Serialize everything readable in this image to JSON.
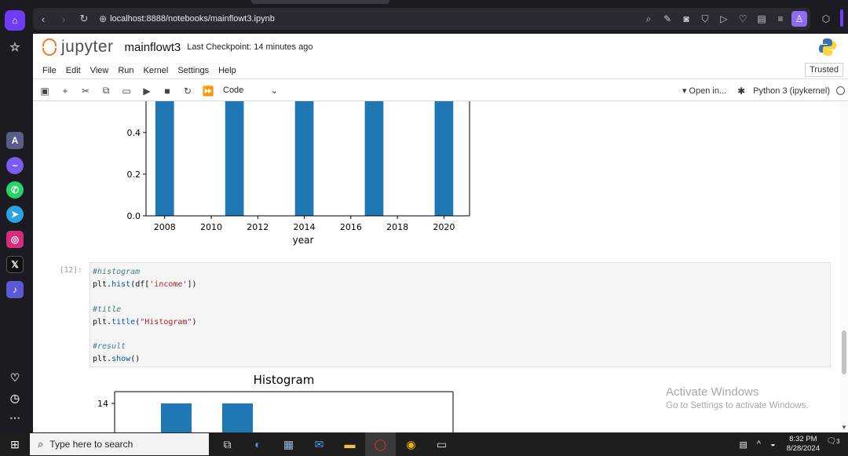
{
  "browser": {
    "url": "localhost:8888/notebooks/mainflowt3.ipynb",
    "sidebar_icons": [
      "home-icon",
      "bookmark-icon",
      "aria-icon",
      "messenger-icon",
      "whatsapp-icon",
      "telegram-icon",
      "instagram-icon",
      "x-icon",
      "music-icon",
      "heart-icon",
      "history-icon",
      "more-icon"
    ],
    "accent": "#6e3cf5"
  },
  "jupyter": {
    "brand": "jupyter",
    "notebook_name": "mainflowt3",
    "checkpoint": "Last Checkpoint: 14 minutes ago",
    "menu": [
      "File",
      "Edit",
      "View",
      "Run",
      "Kernel",
      "Settings",
      "Help"
    ],
    "trusted": "Trusted",
    "cell_type": "Code",
    "open_in": "Open in...",
    "kernel": "Python 3 (ipykernel)"
  },
  "cell": {
    "prompt": "[12]:",
    "lines": [
      {
        "text": "#histogram",
        "kind": "comment"
      },
      {
        "text": "plt.hist(df['income'])",
        "kind": "code"
      },
      {
        "text": "",
        "kind": "blank"
      },
      {
        "text": "#title",
        "kind": "comment"
      },
      {
        "text": "plt.title(\"Histogram\")",
        "kind": "code"
      },
      {
        "text": "",
        "kind": "blank"
      },
      {
        "text": "#result",
        "kind": "comment"
      },
      {
        "text": "plt.show()",
        "kind": "code"
      }
    ]
  },
  "chart_data": [
    {
      "type": "bar",
      "x": [
        2008,
        2011,
        2014,
        2017,
        2020
      ],
      "values": [
        1.0,
        1.0,
        1.0,
        1.0,
        1.0
      ],
      "xlabel": "year",
      "ylabel": "",
      "xticks": [
        "2008",
        "2010",
        "2012",
        "2014",
        "2016",
        "2018",
        "2020"
      ],
      "yticks": [
        "0.0",
        "0.2",
        "0.4"
      ],
      "ylim": [
        0,
        0.55
      ],
      "xlim": [
        2007.2,
        2021.1
      ],
      "color": "#1f77b4",
      "note_partial_view": "top of chart scrolled out of view"
    },
    {
      "type": "bar",
      "title": "Histogram",
      "values": [
        14,
        14
      ],
      "yticks": [
        "14"
      ],
      "color": "#1f77b4"
    }
  ],
  "watermark": {
    "line1": "Activate Windows",
    "line2": "Go to Settings to activate Windows."
  },
  "taskbar": {
    "search_placeholder": "Type here to search",
    "time": "8:32 PM",
    "date": "8/28/2024",
    "notification_count": "3"
  }
}
